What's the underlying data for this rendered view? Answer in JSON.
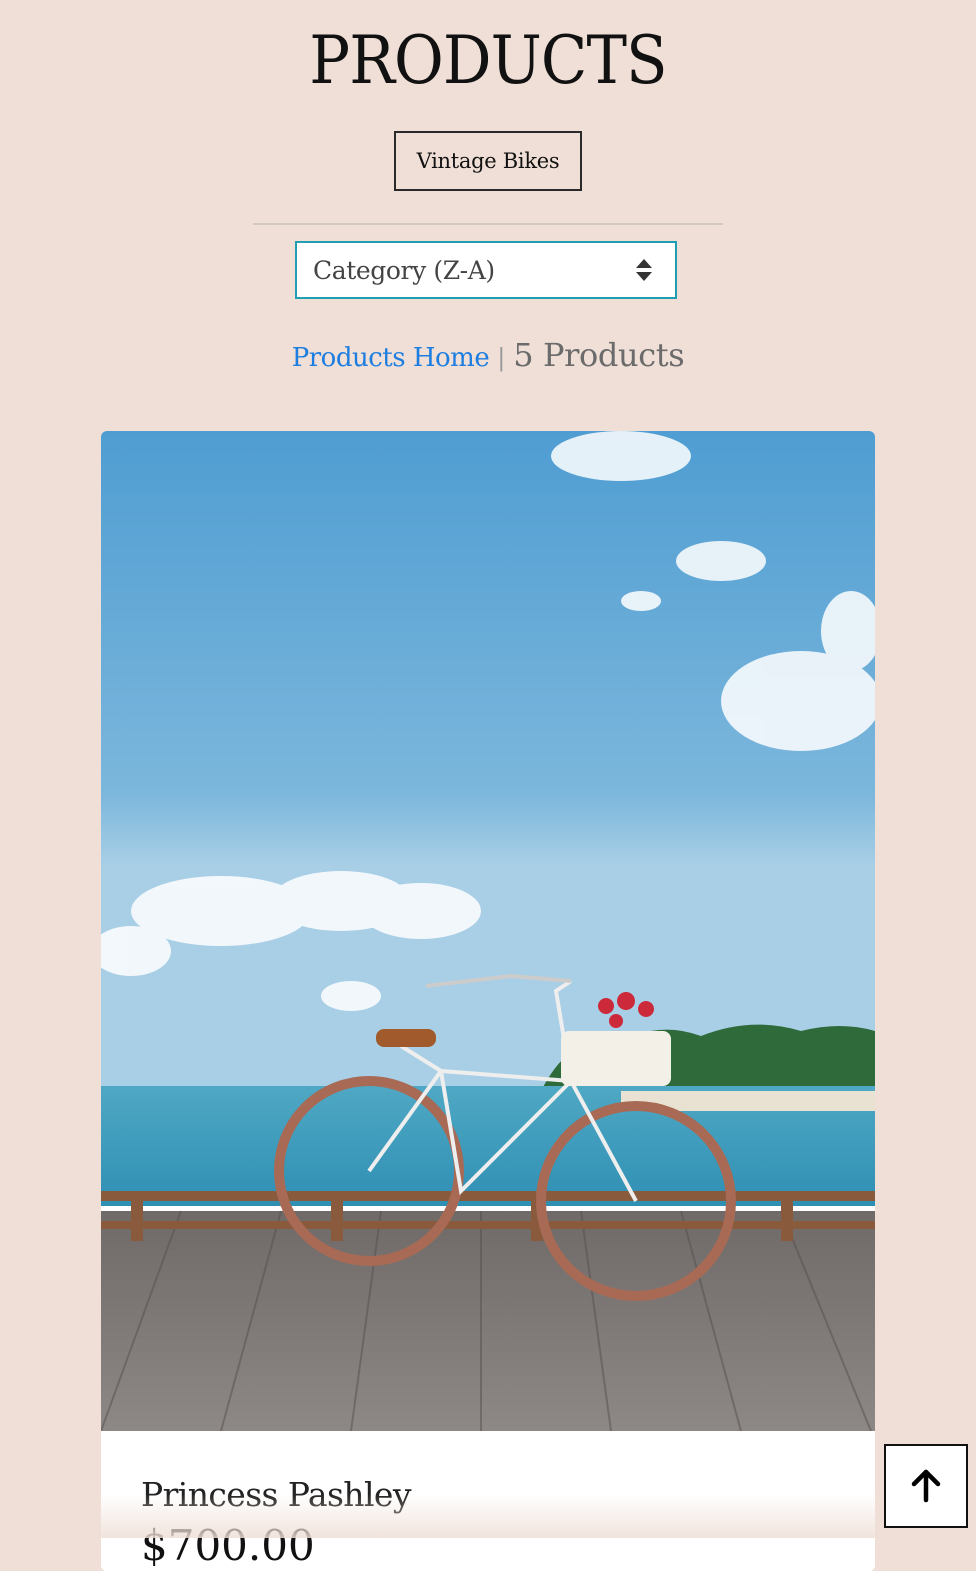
{
  "header": {
    "title": "PRODUCTS",
    "category_button": "Vintage Bikes"
  },
  "sort": {
    "selected": "Category (Z-A)"
  },
  "breadcrumb": {
    "home_link": "Products Home",
    "separator": "|",
    "count": "5 Products"
  },
  "products": [
    {
      "name": "Princess Pashley",
      "price": "$700.00"
    }
  ],
  "icons": {
    "sort": "sort-updown-icon",
    "back_to_top": "arrow-up-icon"
  },
  "colors": {
    "background": "#efdfd7",
    "link": "#1e7ee0",
    "select_border": "#1f9fb1"
  }
}
